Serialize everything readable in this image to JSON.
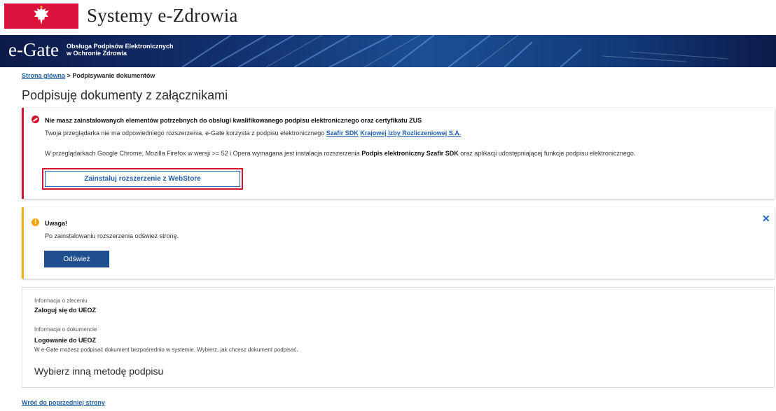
{
  "brand": {
    "title": "Systemy e-Zdrowia",
    "flag_color": "#dc143c"
  },
  "banner": {
    "logo": "e-Gate",
    "subtitle_line1": "Obsługa Podpisów Elektronicznych",
    "subtitle_line2": "w Ochronie Zdrowia",
    "bg_color": "#0d1b4a"
  },
  "breadcrumb": {
    "home": "Strona główna",
    "separator": ">",
    "current": "Podpisywanie dokumentów"
  },
  "page": {
    "title": "Podpisuję dokumenty z załącznikami"
  },
  "error_panel": {
    "icon": "error-circle-icon",
    "heading": "Nie masz zainstalowanych elementów potrzebnych do obsługi kwalifikowanego podpisu elektronicznego oraz certyfikatu ZUS",
    "line1_prefix": "Twoja przeglądarka nie ma odpowiedniego rozszerzenia. e-Gate korzysta z podpisu elektronicznego ",
    "link_sdk": "Szafir SDK",
    "link_kir": "Krajowej Izby Rozliczeniowej S.A.",
    "line2_prefix": "W przeglądarkach Google Chrome, Mozilla Firefox w wersji >= 52 i Opera wymagana jest instalacja rozszerzenia ",
    "line2_bold": "Podpis elektroniczny Szafir SDK",
    "line2_suffix": " oraz aplikacji udostępniającej funkcje podpisu elektronicznego.",
    "install_button": "Zainstaluj rozszerzenie z WebStore",
    "accent": "#d2162e"
  },
  "warning_panel": {
    "icon": "warning-circle-icon",
    "heading": "Uwaga!",
    "text": "Po zainstalowaniu rozszerzenia odśwież stronę.",
    "refresh_button": "Odśwież",
    "close_icon": "close-icon",
    "accent": "#f2b311"
  },
  "info_panel": {
    "order_label": "Informacja o zleceniu",
    "order_value": "Zaloguj się do UEOZ",
    "document_label": "Informacja o dokumencie",
    "document_value": "Logowanie do UEOZ",
    "note": "W e-Gate możesz podpisać dokument bezpośrednio w systemie. Wybierz, jak chcesz dokument podpisać.",
    "method_heading": "Wybierz inną metodę podpisu"
  },
  "footer": {
    "back_link": "Wróć do poprzedniej strony"
  }
}
